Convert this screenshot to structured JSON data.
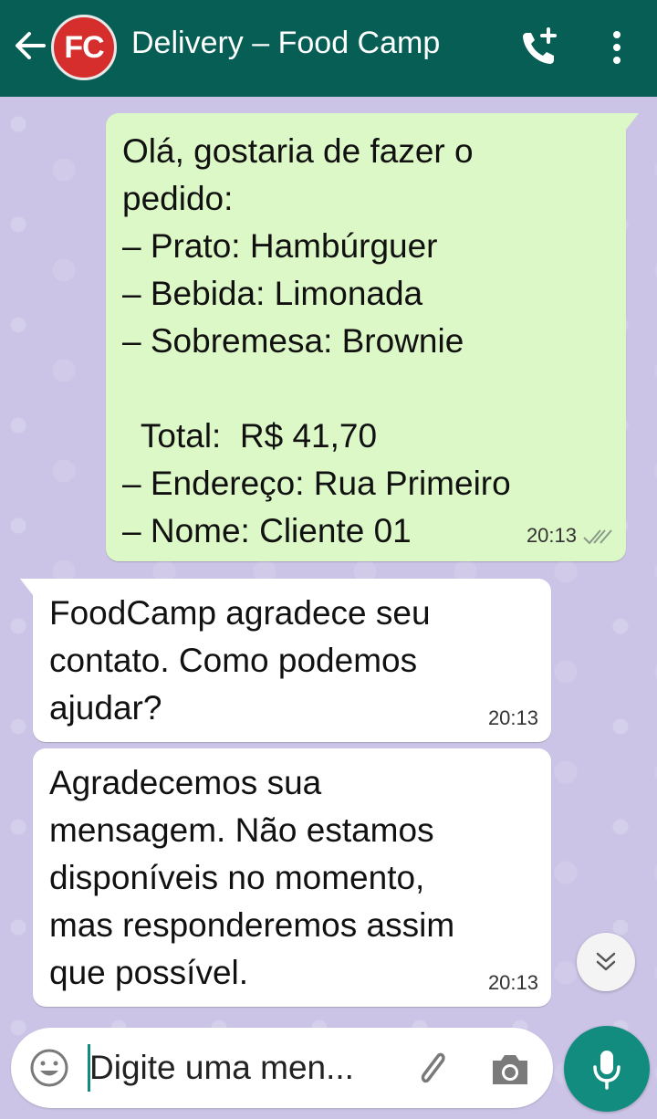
{
  "header": {
    "avatar_text": "FC",
    "title": "Delivery – Food Camp",
    "colors": {
      "bar": "#075e54",
      "avatar": "#d62d2d"
    }
  },
  "messages": [
    {
      "direction": "outgoing",
      "lines": [
        "Olá, gostaria de fazer o",
        "pedido:",
        "– Prato: Hambúrguer",
        "– Bebida: Limonada",
        "– Sobremesa: Brownie",
        "",
        "  Total:  R$ 41,70",
        "– Endereço: Rua Primeiro",
        "– Nome: Cliente 01"
      ],
      "time": "20:13",
      "status": "delivered-double-check"
    },
    {
      "direction": "incoming",
      "lines": [
        "FoodCamp agradece seu",
        "contato. Como podemos",
        "ajudar?"
      ],
      "time": "20:13"
    },
    {
      "direction": "incoming",
      "lines": [
        "Agradecemos sua",
        "mensagem. Não estamos",
        "disponíveis no momento,",
        "mas responderemos assim",
        "que possível."
      ],
      "time": "20:13"
    }
  ],
  "composer": {
    "placeholder": "Digite uma men...",
    "icons": [
      "emoji-icon",
      "paperclip-icon",
      "camera-icon",
      "microphone-icon"
    ]
  },
  "colors": {
    "outgoing_bubble": "#dcf8c6",
    "incoming_bubble": "#ffffff",
    "wallpaper": "#cbc4e6",
    "accent": "#128c7e"
  }
}
